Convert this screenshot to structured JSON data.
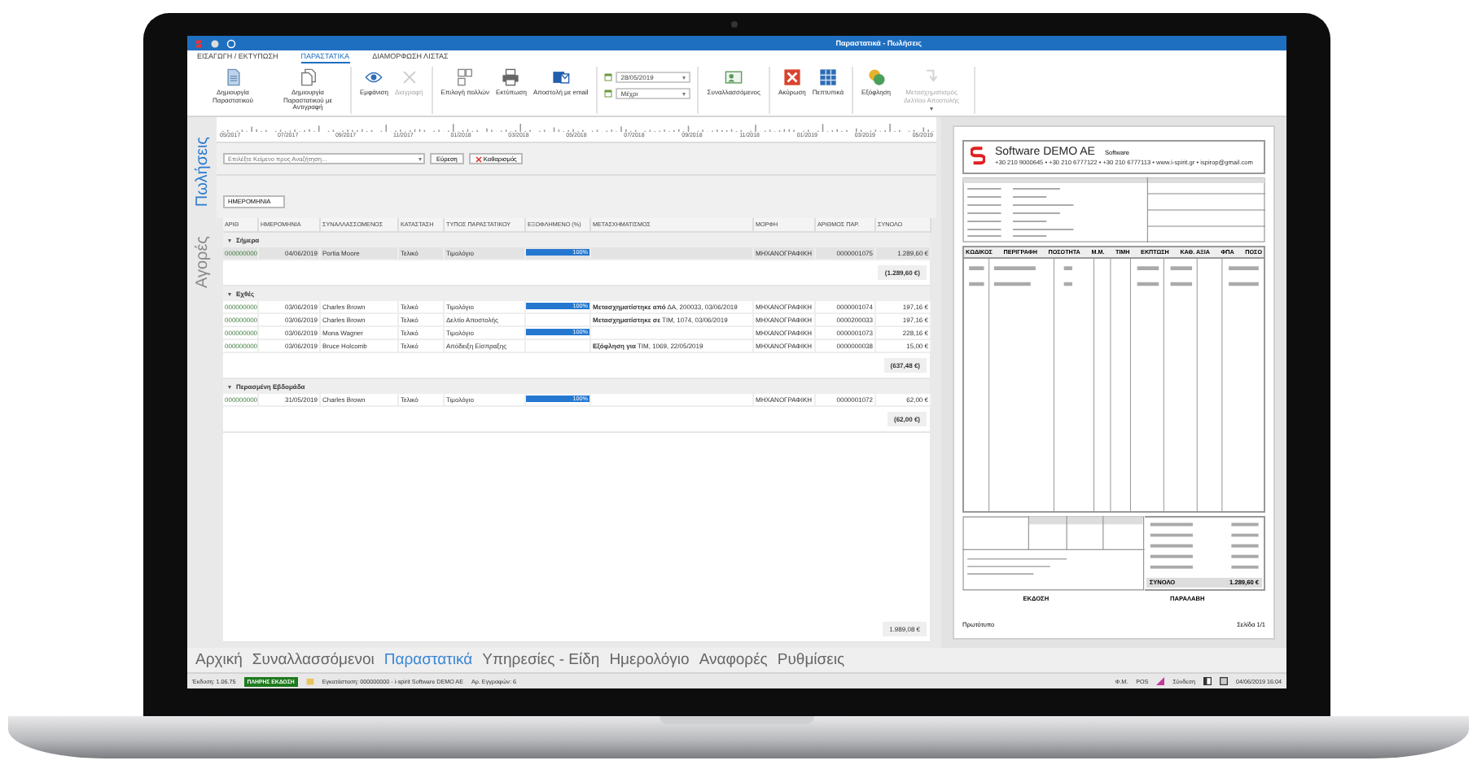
{
  "window": {
    "title": "Παραστατικά - Πωλήσεις"
  },
  "ribbon_tabs": [
    {
      "label": "ΕΙΣΑΓΩΓΗ / ΕΚΤΥΠΩΣΗ",
      "selected": false
    },
    {
      "label": "ΠΑΡΑΣΤΑΤΙΚΑ",
      "selected": true
    },
    {
      "label": "ΔΙΑΜΟΡΦΩΣΗ ΛΙΣΤΑΣ",
      "selected": false
    }
  ],
  "ribbon_groups": [
    [
      {
        "kind": "button",
        "label": "Δημιουργία Παραστατικού",
        "disabled": false
      },
      {
        "kind": "button",
        "label": "Δημιουργία Παραστατικού με Αντιγραφή",
        "disabled": false
      }
    ],
    [
      {
        "kind": "button",
        "label": "Εμφάνιση",
        "disabled": false
      },
      {
        "kind": "button",
        "label": "Διαγραφή",
        "disabled": true
      }
    ],
    [
      {
        "kind": "button",
        "label": "Επιλογή πολλών",
        "disabled": false
      },
      {
        "kind": "button",
        "label": "Εκτύπωση",
        "disabled": false
      },
      {
        "kind": "button",
        "label": "Αποστολή με email",
        "disabled": false
      }
    ],
    [
      {
        "kind": "date",
        "value": "28/05/2019"
      },
      {
        "kind": "date",
        "value": "Μέχρι"
      }
    ],
    [
      {
        "kind": "button",
        "label": "Συναλλασσόμενος",
        "disabled": false
      }
    ],
    [
      {
        "kind": "button",
        "label": "Ακύρωση",
        "disabled": false
      },
      {
        "kind": "button",
        "label": "Πεπτυπικά",
        "disabled": false
      }
    ],
    [
      {
        "kind": "button",
        "label": "Εξόφληση",
        "disabled": false
      },
      {
        "kind": "menu",
        "label": "Μετασχηματισμός Δελτίου Αποστολής",
        "disabled": true
      }
    ]
  ],
  "side_tabs": [
    {
      "label": "Πωλήσεις",
      "selected": true
    },
    {
      "label": "Αγορές",
      "selected": false
    }
  ],
  "timeline": {
    "labels": [
      "05/2017",
      "07/2017",
      "09/2017",
      "11/2017",
      "01/2018",
      "03/2018",
      "05/2018",
      "07/2018",
      "09/2018",
      "11/2018",
      "01/2019",
      "03/2019",
      "05/2019"
    ]
  },
  "search": {
    "placeholder": "Επιλέξτε Κείμενο προς Αναζήτηση...",
    "find_button": "Εύρεση",
    "clear_button": "Καθαρισμός"
  },
  "group_by": "ΗΜΕΡΟΜΗΝΙΑ",
  "table": {
    "columns": [
      "ΑΡΙΘ",
      "ΗΜΕΡΟΜΗΝΙΑ",
      "ΣΥΝΑΛΛΑΣΣΟΜΕΝΟΣ",
      "ΚΑΤΑΣΤΑΣΗ",
      "ΤΥΠΟΣ ΠΑΡΑΣΤΑΤΙΚΟΥ",
      "ΕΞΟΦΛΗΜΕΝΟ (%)",
      "ΜΕΤΑΣΧΗΜΑΤΙΣΜΟΣ",
      "ΜΟΡΦΗ",
      "ΑΡΙΘΜΟΣ ΠΑΡ.",
      "ΣΥΝΟΛΟ"
    ],
    "groups": [
      {
        "label": "Σήμερα",
        "expanded": true,
        "total": "(1.289,60 €)",
        "rows": [
          {
            "number": "000000000",
            "date": "04/06/2019",
            "party": "Portia Moore",
            "status": "Τελικό",
            "type": "Τιμολόγιο",
            "paid": {
              "level": 1,
              "label": "100%"
            },
            "form": "ΜΗΧΑΝΟΓΡΑΦΙΚΗ",
            "doc_number": "0000001075",
            "total": "1.289,60 €",
            "selected": true
          }
        ]
      },
      {
        "label": "Εχθές",
        "expanded": true,
        "total": "(637,48 €)",
        "rows": [
          {
            "number": "000000000",
            "date": "03/06/2019",
            "party": "Charles Brown",
            "status": "Τελικό",
            "type": "Τιμολόγιο",
            "paid": {
              "level": 1,
              "label": "100%"
            },
            "transformation": "**Μετασχηματίστηκε από** ΔΑ, 200033, 03/06/2019",
            "form": "ΜΗΧΑΝΟΓΡΑΦΙΚΗ",
            "doc_number": "0000001074",
            "total": "197,16 €",
            "selected": false
          },
          {
            "number": "000000000",
            "date": "03/06/2019",
            "party": "Charles Brown",
            "status": "Τελικό",
            "type": "Δελτίο Αποστολής",
            "transformation": "**Μετασχηματίστηκε σε** ΤΙΜ, 1074, 03/06/2019",
            "form": "ΜΗΧΑΝΟΓΡΑΦΙΚΗ",
            "doc_number": "0000200033",
            "total": "197,16 €",
            "selected": false
          },
          {
            "number": "000000000",
            "date": "03/06/2019",
            "party": "Mona Wagner",
            "status": "Τελικό",
            "type": "Τιμολόγιο",
            "paid": {
              "level": 1,
              "label": "100%"
            },
            "form": "ΜΗΧΑΝΟΓΡΑΦΙΚΗ",
            "doc_number": "0000001073",
            "total": "228,16 €",
            "selected": false
          },
          {
            "number": "000000000",
            "date": "03/06/2019",
            "party": "Bruce Holcomb",
            "status": "Τελικό",
            "type": "Απόδειξη Είσπραξης",
            "transformation": "**Εξόφληση για** ΤΙΜ, 1069, 22/05/2019",
            "form": "ΜΗΧΑΝΟΓΡΑΦΙΚΗ",
            "doc_number": "0000000038",
            "total": "15,00 €",
            "selected": false
          }
        ]
      },
      {
        "label": "Περασμένη Εβδομάδα",
        "expanded": true,
        "total": "(62,00 €)",
        "rows": [
          {
            "number": "000000000",
            "date": "31/05/2019",
            "party": "Charles Brown",
            "status": "Τελικό",
            "type": "Τιμολόγιο",
            "paid": {
              "level": 1,
              "label": "100%"
            },
            "form": "ΜΗΧΑΝΟΓΡΑΦΙΚΗ",
            "doc_number": "0000001072",
            "total": "62,00 €",
            "selected": false
          }
        ]
      }
    ],
    "grand_total": "1.989,08 €"
  },
  "preview": {
    "company": "Software DEMO AE",
    "subtitle": "Software",
    "contacts": "+30 210 9000645 • +30 210 6777122 • +30 210 6777113 • www.i-spirit.gr • ispirop@gmail.com",
    "item_columns": [
      "ΚΩΔΙΚΟΣ",
      "ΠΕΡΙΓΡΑΦΗ",
      "ΠΟΣΟΤΗΤΑ",
      "Μ.Μ.",
      "ΤΙΜΗ",
      "ΕΚΠΤΩΣΗ",
      "ΚΑΘ. ΑΞΙΑ",
      "ΦΠΑ",
      "ΠΟΣΟ"
    ],
    "total_label": "ΣΥΝΟΛΟ",
    "total": "1.289,60 €",
    "issuer_label": "ΕΚΔΟΣΗ",
    "receiver_label": "ΠΑΡΑΛΑΒΗ",
    "copy_label": "Πρωτότυπο",
    "page_label": "Σελίδα 1/1"
  },
  "nav": [
    {
      "label": "Αρχική",
      "selected": false
    },
    {
      "label": "Συναλλασσόμενοι",
      "selected": false
    },
    {
      "label": "Παραστατικά",
      "selected": true
    },
    {
      "label": "Υπηρεσίες - Είδη",
      "selected": false
    },
    {
      "label": "Ημερολόγιο",
      "selected": false
    },
    {
      "label": "Αναφορές",
      "selected": false
    },
    {
      "label": "Ρυθμίσεις",
      "selected": false
    }
  ],
  "status_bar": {
    "version": "Έκδοση: 1.06.75",
    "edition": "ΠΛΗΡΗΣ ΕΚΔΟΣΗ",
    "installation": "Εγκατάσταση: 000000000 - i-spirit Software DEMO AE",
    "records": "Αρ. Εγγραφών: 6",
    "right": [
      "Φ.Μ.",
      "POS",
      "Σύνδεση"
    ],
    "datetime": "04/06/2019 16:04"
  }
}
